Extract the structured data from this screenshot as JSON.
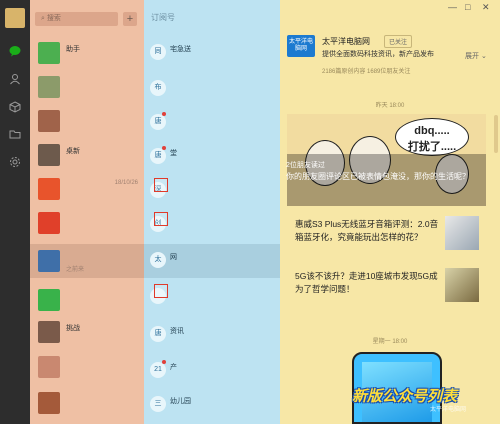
{
  "app": {
    "colors": {
      "rail": "#2d2d2d",
      "chat_list_bg": "#efc0a4",
      "sub_list_bg": "#bde3f2",
      "panel_bg": "#f7e7a6",
      "accent_green": "#1aad19"
    }
  },
  "rail": {
    "icons": [
      "chat-icon",
      "contacts-icon",
      "cube-icon",
      "folder-icon",
      "settings-icon"
    ]
  },
  "search": {
    "placeholder": "搜索",
    "add_label": "+"
  },
  "chat_list": {
    "items": [
      {
        "name": "助手",
        "time": "",
        "snippet": ""
      },
      {
        "name": "",
        "time": "",
        "snippet": ""
      },
      {
        "name": "",
        "time": "",
        "snippet": ""
      },
      {
        "name": "桌新",
        "time": "",
        "snippet": ""
      },
      {
        "name": "",
        "time": "18/10/26",
        "snippet": ""
      },
      {
        "name": "",
        "time": "",
        "snippet": ""
      },
      {
        "name": "",
        "time": "",
        "snippet": "之前来"
      },
      {
        "name": "",
        "time": "",
        "snippet": ""
      },
      {
        "name": "挑战",
        "time": "",
        "snippet": ""
      },
      {
        "name": "",
        "time": "",
        "snippet": ""
      },
      {
        "name": "",
        "time": "",
        "snippet": ""
      }
    ]
  },
  "subscriptions": {
    "header": "订阅号",
    "items": [
      {
        "icon_text": "同",
        "name": "同",
        "time": "",
        "snippet": "宅急送"
      },
      {
        "icon_text": "布",
        "name": "布",
        "time": "",
        "snippet": ""
      },
      {
        "icon_text": "唐",
        "name": "唐",
        "time": "",
        "snippet": ""
      },
      {
        "icon_text": "唐",
        "name": "唐",
        "time": "",
        "snippet": "堂"
      },
      {
        "icon_text": "深",
        "name": "深",
        "time": "",
        "snippet": ""
      },
      {
        "icon_text": "创",
        "name": "创",
        "time": "",
        "snippet": ""
      },
      {
        "icon_text": "太",
        "name": "太",
        "time": "",
        "snippet": "网"
      },
      {
        "icon_text": "",
        "name": "",
        "time": "",
        "snippet": ""
      },
      {
        "icon_text": "唐",
        "name": "唐",
        "time": "",
        "snippet": "资讯"
      },
      {
        "icon_text": "21",
        "name": "21",
        "time": "",
        "snippet": "产"
      },
      {
        "icon_text": "三",
        "name": "三",
        "time": "",
        "snippet": "幼儿园"
      }
    ]
  },
  "panel": {
    "logo_text": "太平洋电脑网",
    "name": "太平洋电脑网",
    "followed_label": "已关注",
    "description": "提供全面数码科技资讯，新产品发布",
    "stats": "2186篇原创内容  1689位朋友关注",
    "expand_label": "展开",
    "time_sep_1": "昨天 18:00",
    "time_sep_2": "星期一 18:00",
    "hero": {
      "bubble_line1": "dbq.....",
      "bubble_line2": "打扰了.....",
      "cap_small": "2位朋友读过",
      "caption": "你的朋友圈评论区已被表情包淹没，那你的生活呢？"
    },
    "articles": [
      {
        "title": "惠威S3 Plus无线蓝牙音箱评测：2.0音箱蓝牙化，究竟能玩出怎样的花？"
      },
      {
        "title": "5G该不该升？走进10座城市发现5G成为了哲学问题！"
      }
    ],
    "banner": "新版公众号列表",
    "watermark": "太平洋电脑网"
  }
}
